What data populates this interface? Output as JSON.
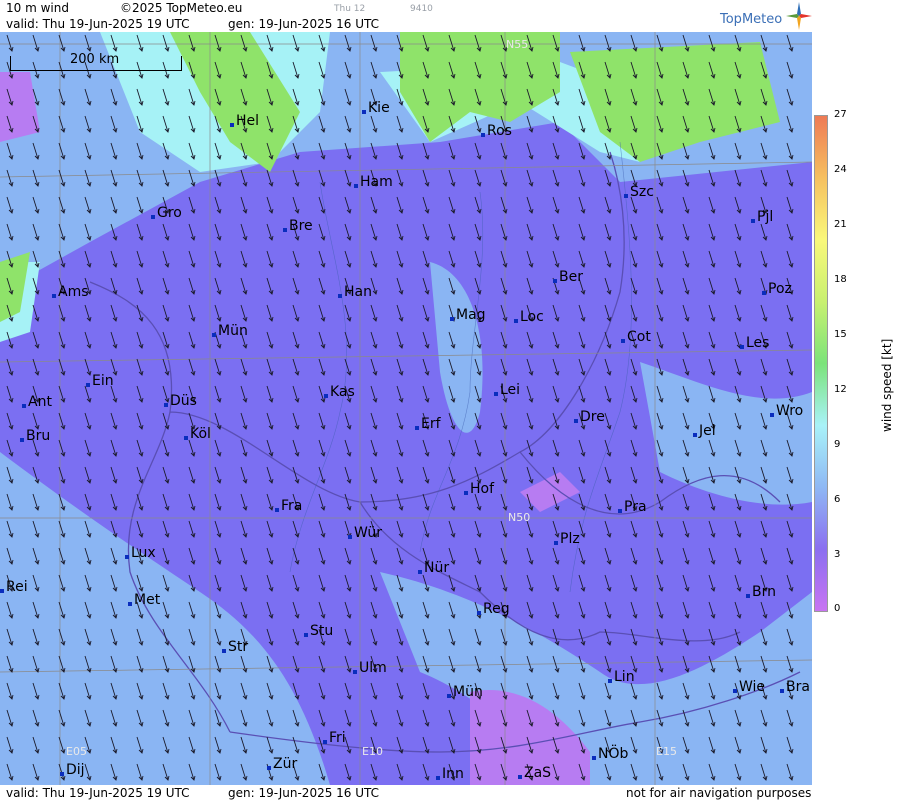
{
  "header": {
    "product": "10 m wind",
    "copyright": "©2025 TopMeteo.eu",
    "faint_day": "Thu 12",
    "faint_code": "9410",
    "valid": "valid:  Thu  19-Jun-2025  19 UTC",
    "gen": "gen: 19-Jun-2025 16 UTC",
    "brand": "TopMeteo"
  },
  "footer": {
    "valid": "valid:  Thu  19-Jun-2025  19 UTC",
    "gen": "gen: 19-Jun-2025 16 UTC",
    "note": "not for air navigation purposes"
  },
  "scale": {
    "label": "200 km"
  },
  "grid_labels": {
    "n55": "N55",
    "n50": "N50",
    "e05": "E05",
    "e10": "E10",
    "e15": "E15"
  },
  "legend": {
    "title": "wind speed [kt]",
    "ticks": [
      "27",
      "24",
      "21",
      "18",
      "15",
      "12",
      "9",
      "6",
      "3",
      "0"
    ],
    "colors": [
      "#c874f2",
      "#8b6ff0",
      "#8fb8f4",
      "#a8f2f8",
      "#7be37a",
      "#c8f070",
      "#f9f87a",
      "#f6c060",
      "#ee7a55"
    ]
  },
  "map_colors": {
    "violet": "#7b6ff2",
    "lightblue": "#8bb8f2",
    "cyan": "#a6f2f6",
    "green": "#8fe36a",
    "lilac": "#b77cf2",
    "border": "#5a4fb4",
    "grid": "#8a8a8a"
  },
  "cities": [
    {
      "name": "Hel"
    },
    {
      "name": "Kie"
    },
    {
      "name": "Ros"
    },
    {
      "name": "Ham"
    },
    {
      "name": "Szc"
    },
    {
      "name": "Gro"
    },
    {
      "name": "Bre"
    },
    {
      "name": "Pjl"
    },
    {
      "name": "Ber"
    },
    {
      "name": "Ams"
    },
    {
      "name": "Han"
    },
    {
      "name": "Poz"
    },
    {
      "name": "Mag"
    },
    {
      "name": "Loc"
    },
    {
      "name": "Mün"
    },
    {
      "name": "Cot"
    },
    {
      "name": "Les"
    },
    {
      "name": "Ein"
    },
    {
      "name": "Kas"
    },
    {
      "name": "Lei"
    },
    {
      "name": "Ant"
    },
    {
      "name": "Düs"
    },
    {
      "name": "Dre"
    },
    {
      "name": "Wro"
    },
    {
      "name": "Erf"
    },
    {
      "name": "Bru"
    },
    {
      "name": "Köl"
    },
    {
      "name": "Jel"
    },
    {
      "name": "Hof"
    },
    {
      "name": "Fra"
    },
    {
      "name": "Pra"
    },
    {
      "name": "Wür"
    },
    {
      "name": "Lux"
    },
    {
      "name": "Plz"
    },
    {
      "name": "Nür"
    },
    {
      "name": "Rei"
    },
    {
      "name": "Met"
    },
    {
      "name": "Reg"
    },
    {
      "name": "Brn"
    },
    {
      "name": "Stu"
    },
    {
      "name": "Str"
    },
    {
      "name": "Ulm"
    },
    {
      "name": "Lin"
    },
    {
      "name": "Mün"
    },
    {
      "name": "Wie"
    },
    {
      "name": "Bra"
    },
    {
      "name": "Fri"
    },
    {
      "name": "NÖb"
    },
    {
      "name": "Dij"
    },
    {
      "name": "Zür"
    },
    {
      "name": "Inn"
    },
    {
      "name": "ZaS"
    }
  ]
}
